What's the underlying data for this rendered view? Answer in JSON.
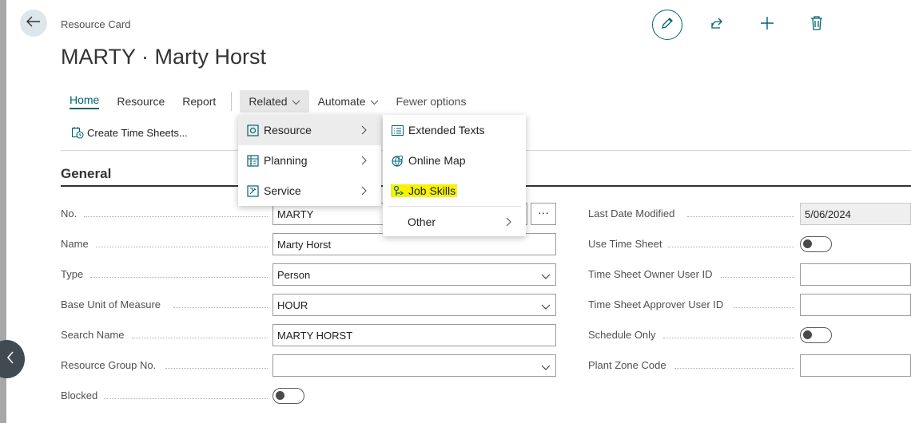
{
  "header": {
    "breadcrumb": "Resource Card",
    "title": "MARTY · Marty Horst"
  },
  "header_actions": [
    "edit-icon",
    "share-icon",
    "plus-icon",
    "delete-icon"
  ],
  "tabs": {
    "home": "Home",
    "resource": "Resource",
    "report": "Report",
    "related": "Related",
    "automate": "Automate",
    "fewer": "Fewer options"
  },
  "actionbar": {
    "create_time_sheets": "Create Time Sheets..."
  },
  "section": {
    "title": "General"
  },
  "fields": {
    "no": {
      "label": "No.",
      "value": "MARTY"
    },
    "name": {
      "label": "Name",
      "value": "Marty Horst"
    },
    "type": {
      "label": "Type",
      "value": "Person"
    },
    "base_uom": {
      "label": "Base Unit of Measure",
      "value": "HOUR"
    },
    "search_name": {
      "label": "Search Name",
      "value": "MARTY HORST"
    },
    "resource_group": {
      "label": "Resource Group No.",
      "value": ""
    },
    "blocked": {
      "label": "Blocked",
      "value": false
    },
    "last_modified": {
      "label": "Last Date Modified",
      "value": "5/06/2024"
    },
    "use_time_sheet": {
      "label": "Use Time Sheet",
      "value": false
    },
    "ts_owner": {
      "label": "Time Sheet Owner User ID",
      "value": ""
    },
    "ts_approver": {
      "label": "Time Sheet Approver User ID",
      "value": ""
    },
    "schedule_only": {
      "label": "Schedule Only",
      "value": false
    },
    "plant_zone": {
      "label": "Plant Zone Code",
      "value": ""
    }
  },
  "related_menu": {
    "items": [
      "Resource",
      "Planning",
      "Service"
    ]
  },
  "resource_submenu": {
    "items": [
      "Extended Texts",
      "Online Map",
      "Job Skills",
      "Other"
    ]
  },
  "ellipsis": "···",
  "colors": {
    "accent": "#00646f",
    "highlight": "#f6f200",
    "menu_hover": "#ececec"
  }
}
